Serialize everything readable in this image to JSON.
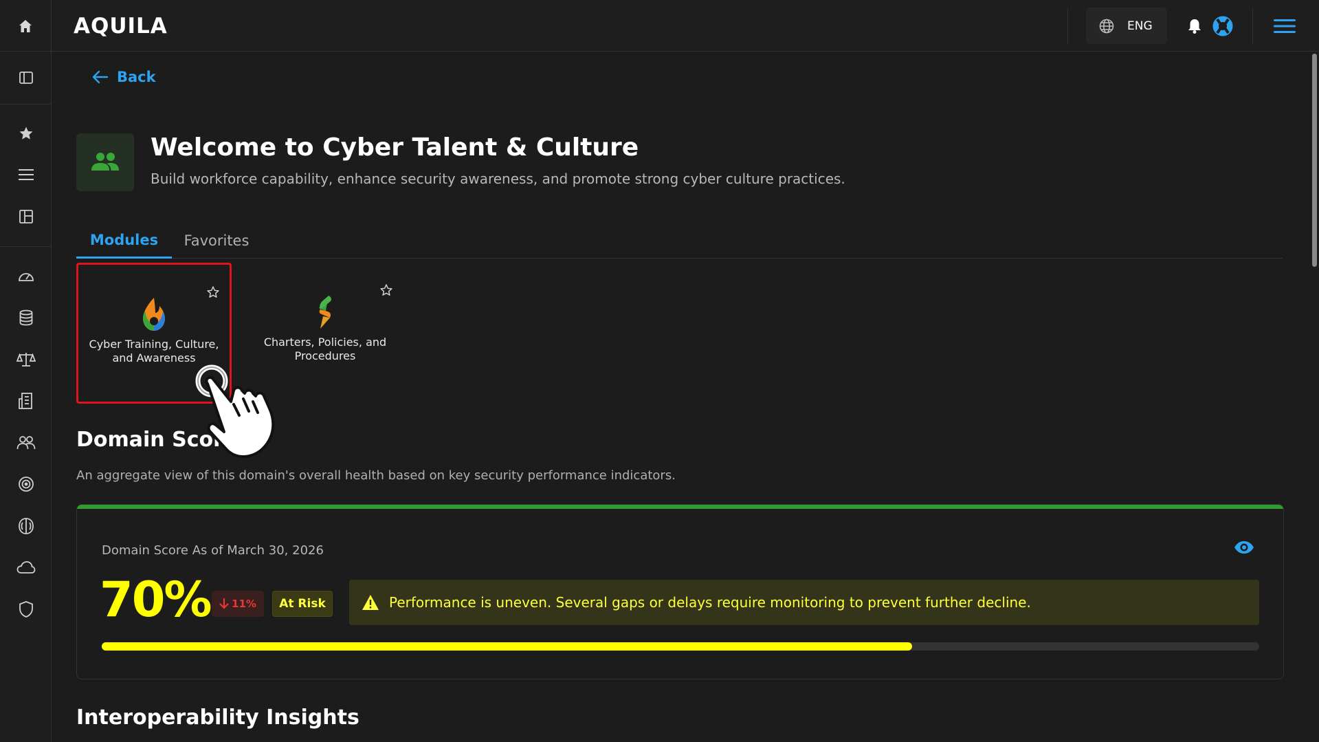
{
  "app": {
    "logo_text": "AQUILA"
  },
  "header": {
    "language_label": "ENG"
  },
  "icons": {
    "home": "home-icon",
    "sidebar_toggle": "panel-icon",
    "favorites": "star-icon",
    "menu": "list-icon",
    "layout": "layout-icon",
    "dashboard": "gauge-icon",
    "database": "database-icon",
    "compliance": "scale-icon",
    "reports": "building-icon",
    "people": "people-icon",
    "target": "target-icon",
    "brain": "brain-icon",
    "cloud": "cloud-icon",
    "shield": "shield-icon",
    "globe": "globe-icon",
    "bell": "bell-icon",
    "help": "lifebuoy-icon",
    "hamburger": "hamburger-icon"
  },
  "page": {
    "back_label": "Back",
    "title": "Welcome to Cyber Talent & Culture",
    "subtitle": "Build workforce capability, enhance security awareness, and promote strong cyber culture practices."
  },
  "tabs": [
    {
      "label": "Modules",
      "active": true
    },
    {
      "label": "Favorites",
      "active": false
    }
  ],
  "modules": [
    {
      "label": "Cyber Training, Culture, and Awareness",
      "favorited": false,
      "selected": true
    },
    {
      "label": "Charters, Policies, and Procedures",
      "favorited": false,
      "selected": false
    }
  ],
  "domain_score": {
    "title": "Domain Score",
    "description": "An aggregate view of this domain's overall health based on key security performance indicators.",
    "date_label": "Domain Score As of March 30, 2026",
    "value": "70%",
    "value_fraction": 0.7,
    "delta": "11%",
    "delta_direction": "down",
    "status": "At Risk",
    "alert": "Performance is uneven. Several gaps or delays require monitoring to prevent further decline."
  },
  "next_section_title": "Interoperability Insights",
  "colors": {
    "accent": "#2ea3f2",
    "score": "#ffff00",
    "status_bar": "#2f9e2f",
    "alert_bg": "#34341b",
    "delta": "#e53935",
    "highlight": "#e0141a"
  }
}
